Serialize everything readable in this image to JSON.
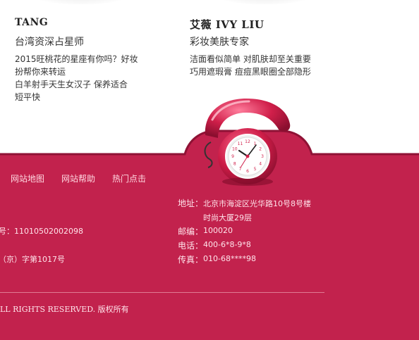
{
  "experts": [
    {
      "name": "TANG",
      "title": "台湾资深占星师",
      "desc": [
        "2015旺桃花的星座有你吗？好妆",
        "扮帮你来转运",
        "白羊射手天生女汉子 保养适合",
        "短平快"
      ]
    },
    {
      "name": "艾薇 IVY LIU",
      "title": "彩妆美肤专家",
      "desc": [
        "洁面看似简单 对肌肤却至关重要",
        "巧用遮瑕膏 痘痘黑眼圈全部隐形"
      ]
    }
  ],
  "footer": {
    "nav": [
      "网站地图",
      "网站帮助",
      "热门点击"
    ],
    "license": "号：11010502002098",
    "permit": "（京）字第1017号",
    "copyright": "LL RIGHTS RESERVED. 版权所有",
    "contact": {
      "address_label": "地址：",
      "address_line1": "北京市海淀区光华路10号8号楼",
      "address_line2": "时尚大厦29层",
      "postcode_label": "邮编：",
      "postcode": "100020",
      "phone_label": "电话：",
      "phone": "400-6*8-9*8",
      "fax_label": "传真：",
      "fax": "010-68****98"
    }
  },
  "clock": {
    "numbers": [
      "12",
      "1",
      "2",
      "3",
      "4",
      "5",
      "6",
      "7",
      "8",
      "9",
      "10",
      "11"
    ]
  },
  "colors": {
    "footer": "#c2224d",
    "footer_dark": "#a81a40",
    "phone_red": "#d01f4a"
  }
}
